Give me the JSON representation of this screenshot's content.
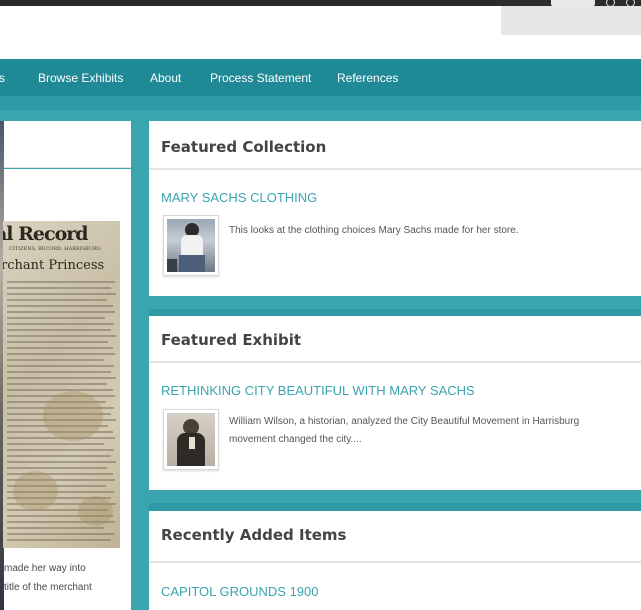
{
  "nav": {
    "items": [
      {
        "label": "s"
      },
      {
        "label": "Browse Exhibits"
      },
      {
        "label": "About"
      },
      {
        "label": "Process Statement"
      },
      {
        "label": "References"
      }
    ]
  },
  "left_panel": {
    "newspaper": {
      "masthead": "al Record",
      "subline": "CITIZENS, RECORD, HARRISBURG",
      "headline": "rchant Princess"
    },
    "caption_lines": [
      "made her way into",
      "title of the merchant"
    ]
  },
  "featured_collection": {
    "heading": "Featured Collection",
    "item_title": "MARY SACHS CLOTHING",
    "item_description": "This looks at the clothing choices Mary Sachs made for her store."
  },
  "featured_exhibit": {
    "heading": "Featured Exhibit",
    "item_title": "RETHINKING CITY BEAUTIFUL WITH MARY SACHS",
    "item_description_line1": "William Wilson, a historian, analyzed the City Beautiful Movement in Harrisburg",
    "item_description_line2": "movement changed the city...."
  },
  "recently_added": {
    "heading": "Recently Added Items",
    "item_title": "CAPITOL GROUNDS 1900"
  },
  "colors": {
    "nav_bar": "#1f8a95",
    "accent_teal": "#3aa4af",
    "link": "#3aa4af"
  },
  "icons": [
    "document-icon",
    "power-icon",
    "settings-icon"
  ]
}
